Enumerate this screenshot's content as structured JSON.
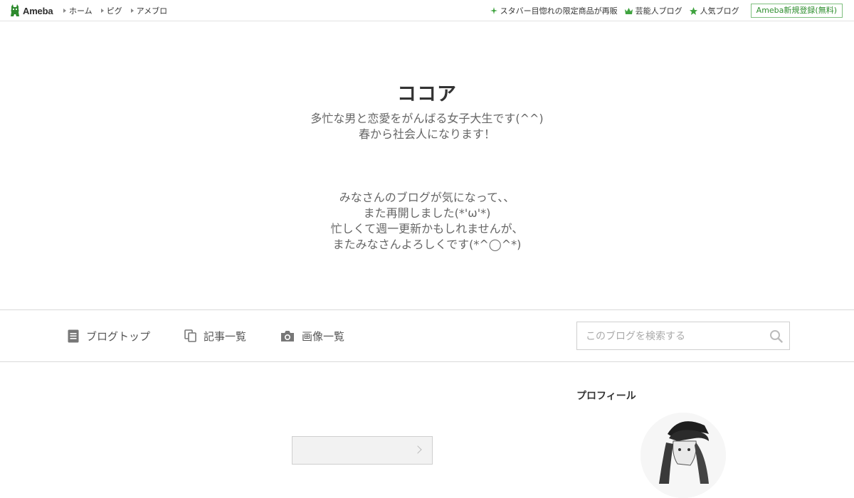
{
  "topbar": {
    "logo_text": "Ameba",
    "nav_left": [
      "ホーム",
      "ピグ",
      "アメブロ"
    ],
    "nav_right": [
      {
        "label": "スタバー目惚れの限定商品が再販",
        "icon": "sparkle-icon"
      },
      {
        "label": "芸能人ブログ",
        "icon": "crown-icon"
      },
      {
        "label": "人気ブログ",
        "icon": "star-icon"
      }
    ],
    "signup_label": "Ameba新規登録(無料)"
  },
  "header": {
    "title": "ココア",
    "description_lines": [
      "多忙な男と恋愛をがんばる女子大生です(^^)",
      "春から社会人になります！",
      "",
      "",
      "みなさんのブログが気になって、、",
      "また再開しました(*'ω'*)",
      "忙しくて週一更新かもしれませんが、",
      "またみなさんよろしくです(*^◯^*)"
    ]
  },
  "tabs": [
    {
      "label": "ブログトップ",
      "icon": "document-icon"
    },
    {
      "label": "記事一覧",
      "icon": "copy-icon"
    },
    {
      "label": "画像一覧",
      "icon": "camera-icon"
    }
  ],
  "search": {
    "placeholder": "このブログを検索する",
    "value": ""
  },
  "sidebar": {
    "profile_heading": "プロフィール"
  },
  "colors": {
    "brand_green": "#2d8a2d",
    "accent_green": "#3fa33f"
  }
}
